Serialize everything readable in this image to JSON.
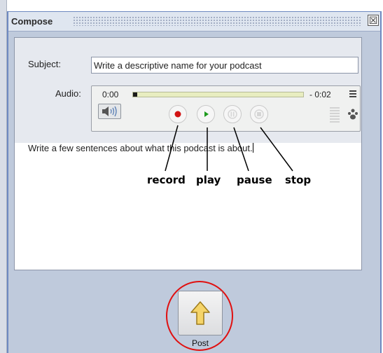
{
  "window": {
    "title": "Compose",
    "close_glyph": "☒"
  },
  "form": {
    "subject_label": "Subject:",
    "subject_value": "Write a descriptive name for your podcast",
    "audio_label": "Audio:"
  },
  "player": {
    "time_current": "0:00",
    "time_remaining": "- 0:02",
    "progress": 0,
    "icons": [
      "speaker-icon",
      "record-icon",
      "play-icon",
      "pause-icon",
      "stop-icon",
      "menu-icon",
      "level-meter-icon",
      "user-icon"
    ]
  },
  "description": {
    "text": "Write a few sentences about what this podcast is about."
  },
  "annotations": {
    "record": "record",
    "play": "play",
    "pause": "pause",
    "stop": "stop"
  },
  "post": {
    "label": "Post"
  },
  "colors": {
    "record_dot": "#d21414",
    "play_triangle": "#1c9a1c",
    "post_arrow": "#f5d469",
    "highlight_ellipse": "#e01010"
  }
}
